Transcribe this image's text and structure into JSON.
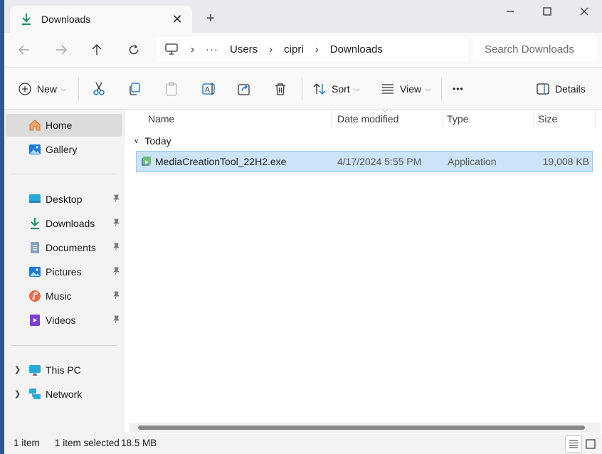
{
  "tab": {
    "title": "Downloads",
    "close": "✕"
  },
  "new_tab": "+",
  "window_controls": {
    "minimize": "minimize-icon",
    "maximize": "maximize-icon",
    "close": "close-icon"
  },
  "address": {
    "separator": "›",
    "overflow": "···",
    "crumbs": [
      "Users",
      "cipri",
      "Downloads"
    ]
  },
  "search": {
    "placeholder": "Search Downloads"
  },
  "toolbar": {
    "new_label": "New",
    "sort_label": "Sort",
    "view_label": "View",
    "more": "•••",
    "details_label": "Details"
  },
  "sidebar": {
    "top": [
      {
        "label": "Home",
        "icon": "home-icon",
        "selected": true
      },
      {
        "label": "Gallery",
        "icon": "gallery-icon"
      }
    ],
    "quick": [
      {
        "label": "Desktop",
        "icon": "desktop-icon"
      },
      {
        "label": "Downloads",
        "icon": "downloads-icon"
      },
      {
        "label": "Documents",
        "icon": "documents-icon"
      },
      {
        "label": "Pictures",
        "icon": "pictures-icon"
      },
      {
        "label": "Music",
        "icon": "music-icon"
      },
      {
        "label": "Videos",
        "icon": "videos-icon"
      }
    ],
    "tree": [
      {
        "label": "This PC",
        "icon": "this-pc-icon"
      },
      {
        "label": "Network",
        "icon": "network-icon"
      }
    ]
  },
  "columns": {
    "name": "Name",
    "date": "Date modified",
    "type": "Type",
    "size": "Size"
  },
  "group": {
    "label": "Today"
  },
  "files": [
    {
      "name": "MediaCreationTool_22H2.exe",
      "date": "4/17/2024 5:55 PM",
      "type": "Application",
      "size": "19,008 KB",
      "selected": true
    }
  ],
  "status": {
    "count": "1 item",
    "selected": "1 item selected",
    "size": "18.5 MB"
  },
  "colors": {
    "selection": "#cce4f7",
    "selection_border": "#99c9ef",
    "accent": "#0f6cbd"
  }
}
